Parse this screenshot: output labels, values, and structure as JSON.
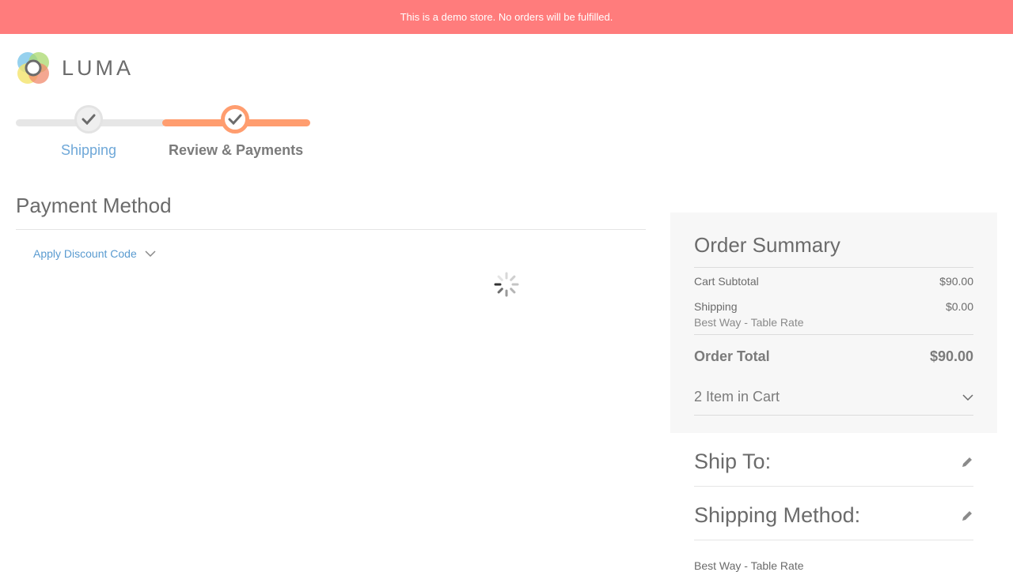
{
  "banner": {
    "text": "This is a demo store. No orders will be fulfilled."
  },
  "logo": {
    "text": "LUMA"
  },
  "progress": {
    "steps": [
      {
        "label": "Shipping",
        "state": "complete"
      },
      {
        "label": "Review & Payments",
        "state": "active"
      }
    ]
  },
  "payment": {
    "title": "Payment Method",
    "discount_label": "Apply Discount Code"
  },
  "summary": {
    "title": "Order Summary",
    "subtotal_label": "Cart Subtotal",
    "subtotal_value": "$90.00",
    "shipping_label": "Shipping",
    "shipping_value": "$0.00",
    "shipping_method": "Best Way - Table Rate",
    "total_label": "Order Total",
    "total_value": "$90.00",
    "items_label": "2 Item in Cart"
  },
  "ship_to": {
    "title": "Ship To:"
  },
  "shipping_method": {
    "title": "Shipping Method:",
    "value": "Best Way - Table Rate"
  },
  "colors": {
    "banner": "#ff7c7c",
    "accent": "#ff9d6f",
    "link": "#5a9bd0"
  }
}
